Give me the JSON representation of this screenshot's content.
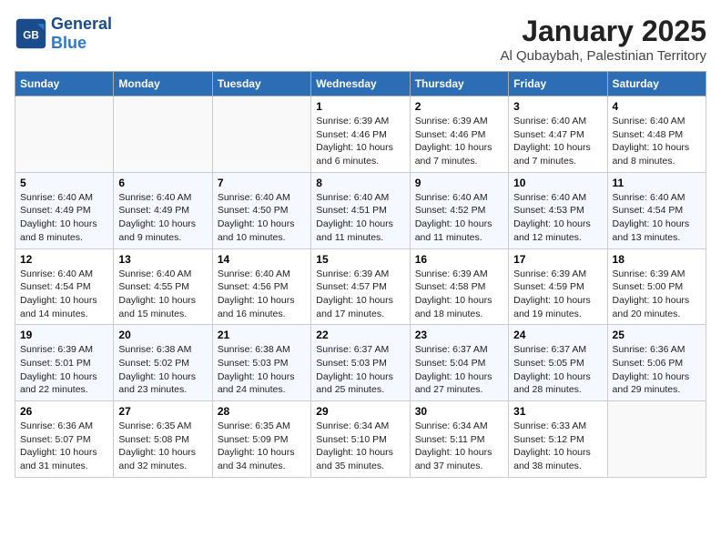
{
  "header": {
    "logo_general": "General",
    "logo_blue": "Blue",
    "title": "January 2025",
    "subtitle": "Al Qubaybah, Palestinian Territory"
  },
  "weekdays": [
    "Sunday",
    "Monday",
    "Tuesday",
    "Wednesday",
    "Thursday",
    "Friday",
    "Saturday"
  ],
  "weeks": [
    [
      {
        "day": "",
        "info": ""
      },
      {
        "day": "",
        "info": ""
      },
      {
        "day": "",
        "info": ""
      },
      {
        "day": "1",
        "info": "Sunrise: 6:39 AM\nSunset: 4:46 PM\nDaylight: 10 hours\nand 6 minutes."
      },
      {
        "day": "2",
        "info": "Sunrise: 6:39 AM\nSunset: 4:46 PM\nDaylight: 10 hours\nand 7 minutes."
      },
      {
        "day": "3",
        "info": "Sunrise: 6:40 AM\nSunset: 4:47 PM\nDaylight: 10 hours\nand 7 minutes."
      },
      {
        "day": "4",
        "info": "Sunrise: 6:40 AM\nSunset: 4:48 PM\nDaylight: 10 hours\nand 8 minutes."
      }
    ],
    [
      {
        "day": "5",
        "info": "Sunrise: 6:40 AM\nSunset: 4:49 PM\nDaylight: 10 hours\nand 8 minutes."
      },
      {
        "day": "6",
        "info": "Sunrise: 6:40 AM\nSunset: 4:49 PM\nDaylight: 10 hours\nand 9 minutes."
      },
      {
        "day": "7",
        "info": "Sunrise: 6:40 AM\nSunset: 4:50 PM\nDaylight: 10 hours\nand 10 minutes."
      },
      {
        "day": "8",
        "info": "Sunrise: 6:40 AM\nSunset: 4:51 PM\nDaylight: 10 hours\nand 11 minutes."
      },
      {
        "day": "9",
        "info": "Sunrise: 6:40 AM\nSunset: 4:52 PM\nDaylight: 10 hours\nand 11 minutes."
      },
      {
        "day": "10",
        "info": "Sunrise: 6:40 AM\nSunset: 4:53 PM\nDaylight: 10 hours\nand 12 minutes."
      },
      {
        "day": "11",
        "info": "Sunrise: 6:40 AM\nSunset: 4:54 PM\nDaylight: 10 hours\nand 13 minutes."
      }
    ],
    [
      {
        "day": "12",
        "info": "Sunrise: 6:40 AM\nSunset: 4:54 PM\nDaylight: 10 hours\nand 14 minutes."
      },
      {
        "day": "13",
        "info": "Sunrise: 6:40 AM\nSunset: 4:55 PM\nDaylight: 10 hours\nand 15 minutes."
      },
      {
        "day": "14",
        "info": "Sunrise: 6:40 AM\nSunset: 4:56 PM\nDaylight: 10 hours\nand 16 minutes."
      },
      {
        "day": "15",
        "info": "Sunrise: 6:39 AM\nSunset: 4:57 PM\nDaylight: 10 hours\nand 17 minutes."
      },
      {
        "day": "16",
        "info": "Sunrise: 6:39 AM\nSunset: 4:58 PM\nDaylight: 10 hours\nand 18 minutes."
      },
      {
        "day": "17",
        "info": "Sunrise: 6:39 AM\nSunset: 4:59 PM\nDaylight: 10 hours\nand 19 minutes."
      },
      {
        "day": "18",
        "info": "Sunrise: 6:39 AM\nSunset: 5:00 PM\nDaylight: 10 hours\nand 20 minutes."
      }
    ],
    [
      {
        "day": "19",
        "info": "Sunrise: 6:39 AM\nSunset: 5:01 PM\nDaylight: 10 hours\nand 22 minutes."
      },
      {
        "day": "20",
        "info": "Sunrise: 6:38 AM\nSunset: 5:02 PM\nDaylight: 10 hours\nand 23 minutes."
      },
      {
        "day": "21",
        "info": "Sunrise: 6:38 AM\nSunset: 5:03 PM\nDaylight: 10 hours\nand 24 minutes."
      },
      {
        "day": "22",
        "info": "Sunrise: 6:37 AM\nSunset: 5:03 PM\nDaylight: 10 hours\nand 25 minutes."
      },
      {
        "day": "23",
        "info": "Sunrise: 6:37 AM\nSunset: 5:04 PM\nDaylight: 10 hours\nand 27 minutes."
      },
      {
        "day": "24",
        "info": "Sunrise: 6:37 AM\nSunset: 5:05 PM\nDaylight: 10 hours\nand 28 minutes."
      },
      {
        "day": "25",
        "info": "Sunrise: 6:36 AM\nSunset: 5:06 PM\nDaylight: 10 hours\nand 29 minutes."
      }
    ],
    [
      {
        "day": "26",
        "info": "Sunrise: 6:36 AM\nSunset: 5:07 PM\nDaylight: 10 hours\nand 31 minutes."
      },
      {
        "day": "27",
        "info": "Sunrise: 6:35 AM\nSunset: 5:08 PM\nDaylight: 10 hours\nand 32 minutes."
      },
      {
        "day": "28",
        "info": "Sunrise: 6:35 AM\nSunset: 5:09 PM\nDaylight: 10 hours\nand 34 minutes."
      },
      {
        "day": "29",
        "info": "Sunrise: 6:34 AM\nSunset: 5:10 PM\nDaylight: 10 hours\nand 35 minutes."
      },
      {
        "day": "30",
        "info": "Sunrise: 6:34 AM\nSunset: 5:11 PM\nDaylight: 10 hours\nand 37 minutes."
      },
      {
        "day": "31",
        "info": "Sunrise: 6:33 AM\nSunset: 5:12 PM\nDaylight: 10 hours\nand 38 minutes."
      },
      {
        "day": "",
        "info": ""
      }
    ]
  ]
}
